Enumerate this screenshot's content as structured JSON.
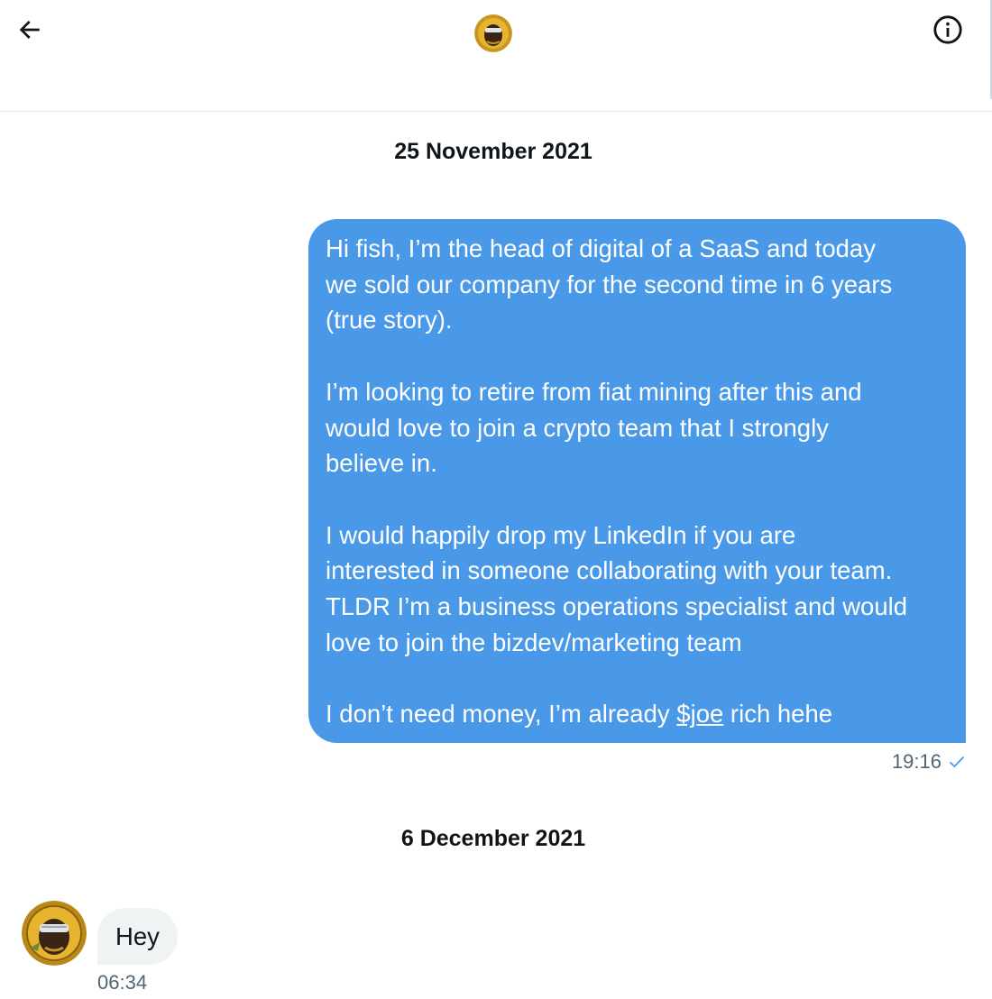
{
  "header": {
    "back_icon": "arrow-left-icon",
    "avatar_icon": "profile-avatar",
    "info_icon": "info-circle-icon"
  },
  "conversation": {
    "date_1": "25 November 2021",
    "sent_message": {
      "paragraph_1": [
        "Hi fish, I’m the head of digital of a SaaS and today",
        "we sold our company for the second time in 6 years",
        "(true story)."
      ],
      "paragraph_2": [
        "I’m looking to retire from fiat mining after this and",
        "would love to join a crypto team that I strongly",
        "believe in."
      ],
      "paragraph_3": [
        "I would happily drop my LinkedIn if you are",
        "interested in someone collaborating with your team.",
        "TLDR I’m a business operations specialist and would",
        "love to join the bizdev/marketing team"
      ],
      "paragraph_4": {
        "before": "I don’t need money, I’m already ",
        "cashtag": "$joe",
        "after": " rich hehe"
      },
      "time": "19:16",
      "status_icon": "check-icon"
    },
    "date_2": "6 December 2021",
    "received_message": {
      "text": "Hey",
      "time": "06:34"
    }
  },
  "colors": {
    "sent_bubble": "#4a99e9",
    "received_bubble": "#eff3f4",
    "text_primary": "#0f1419",
    "text_secondary": "#536471",
    "divider": "#e6ecf0"
  }
}
